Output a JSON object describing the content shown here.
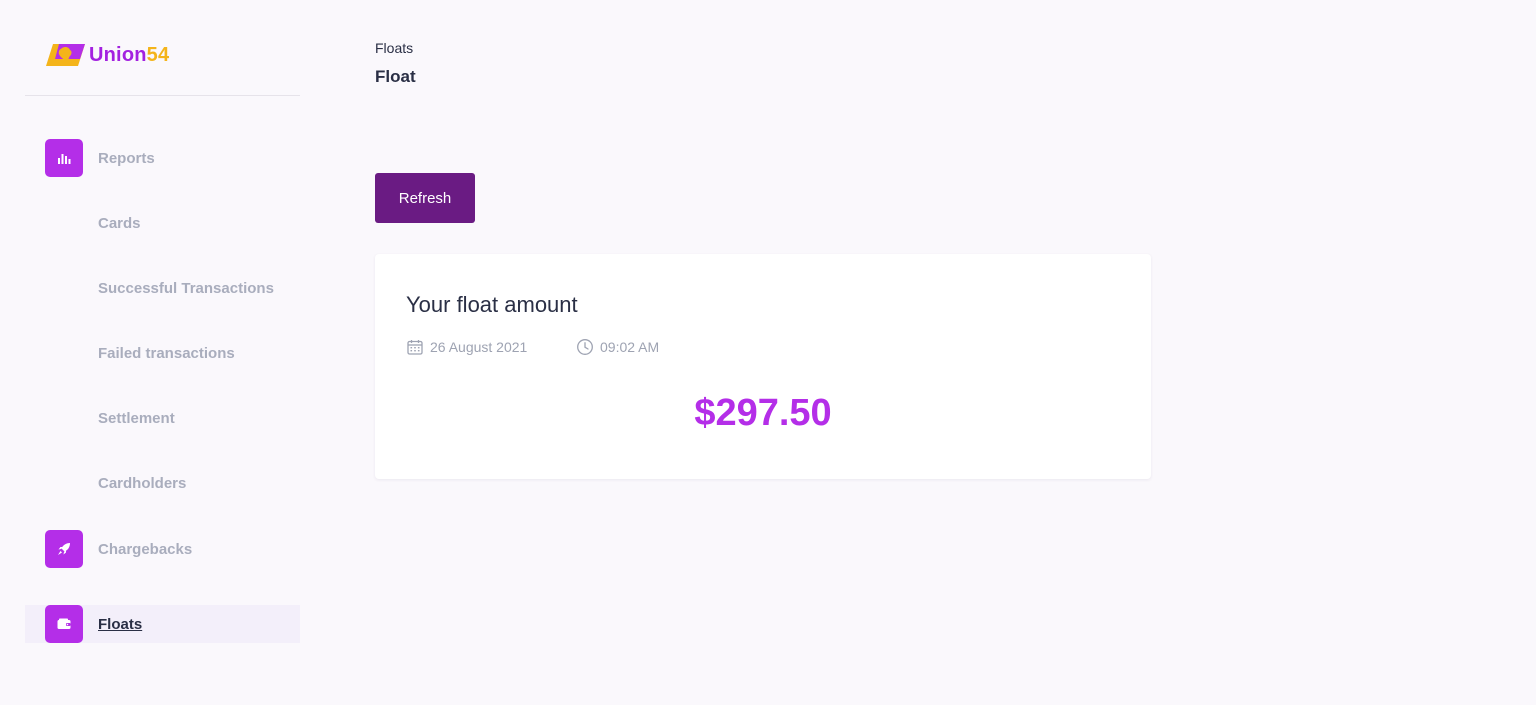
{
  "brand": {
    "name_main": "Union",
    "name_accent": "54"
  },
  "sidebar": {
    "items": [
      {
        "label": "Reports",
        "icon": "bar-chart-icon"
      },
      {
        "label": "Cards",
        "icon": ""
      },
      {
        "label": "Successful Transactions",
        "icon": ""
      },
      {
        "label": "Failed transactions",
        "icon": ""
      },
      {
        "label": "Settlement",
        "icon": ""
      },
      {
        "label": "Cardholders",
        "icon": ""
      },
      {
        "label": "Chargebacks",
        "icon": "rocket-icon"
      },
      {
        "label": "Floats",
        "icon": "wallet-icon",
        "active": true
      }
    ]
  },
  "header": {
    "breadcrumb": "Floats",
    "title": "Float"
  },
  "toolbar": {
    "refresh_label": "Refresh"
  },
  "float_card": {
    "title": "Your float amount",
    "date": "26 August 2021",
    "time": "09:02 AM",
    "amount": "$297.50"
  },
  "colors": {
    "accent": "#b42ee8",
    "brand_purple": "#a321e0",
    "brand_yellow": "#f4b41a",
    "button_bg": "#6a1b83",
    "muted_text": "#a9adbd",
    "background": "#faf8fc"
  }
}
